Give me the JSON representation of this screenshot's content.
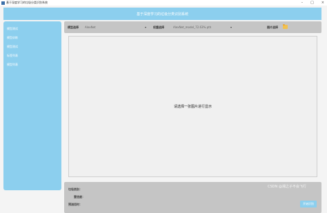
{
  "window": {
    "title": "基于深度学习的垃圾分类识别系统",
    "controls": {
      "minimize": "–",
      "maximize": "□",
      "close": "×"
    }
  },
  "header": {
    "title": "基于深度学习的垃圾分类识别系统"
  },
  "sidebar": {
    "items": [
      {
        "label": "模型测试"
      },
      {
        "label": "模型训练"
      },
      {
        "label": "模型测试"
      },
      {
        "label": "标签列表"
      },
      {
        "label": "模型列表"
      }
    ]
  },
  "toolbar": {
    "model_label": "模型选择",
    "model_value": "AlexNet",
    "weights_label": "权重选择",
    "weights_value": "AlexNet_model_72.63%.pth",
    "image_label": "图片选择"
  },
  "image_area": {
    "placeholder": "请选择一张图片进行显示"
  },
  "bottom": {
    "result_label": "垃圾类别：",
    "result_value": "",
    "confidence_label": "置信度：",
    "confidence_value": "",
    "time_label": "预测用时：",
    "time_value": "",
    "start_button": "开始识别"
  },
  "watermark": "CSDN @湘之子不会飞行",
  "colors": {
    "accent": "#8ccfee",
    "panel": "#c5c5c5",
    "background": "#f4f4f4"
  },
  "icons": {
    "app": "app-icon",
    "folder": "folder-icon",
    "dropdown": "chevron-down-icon"
  }
}
